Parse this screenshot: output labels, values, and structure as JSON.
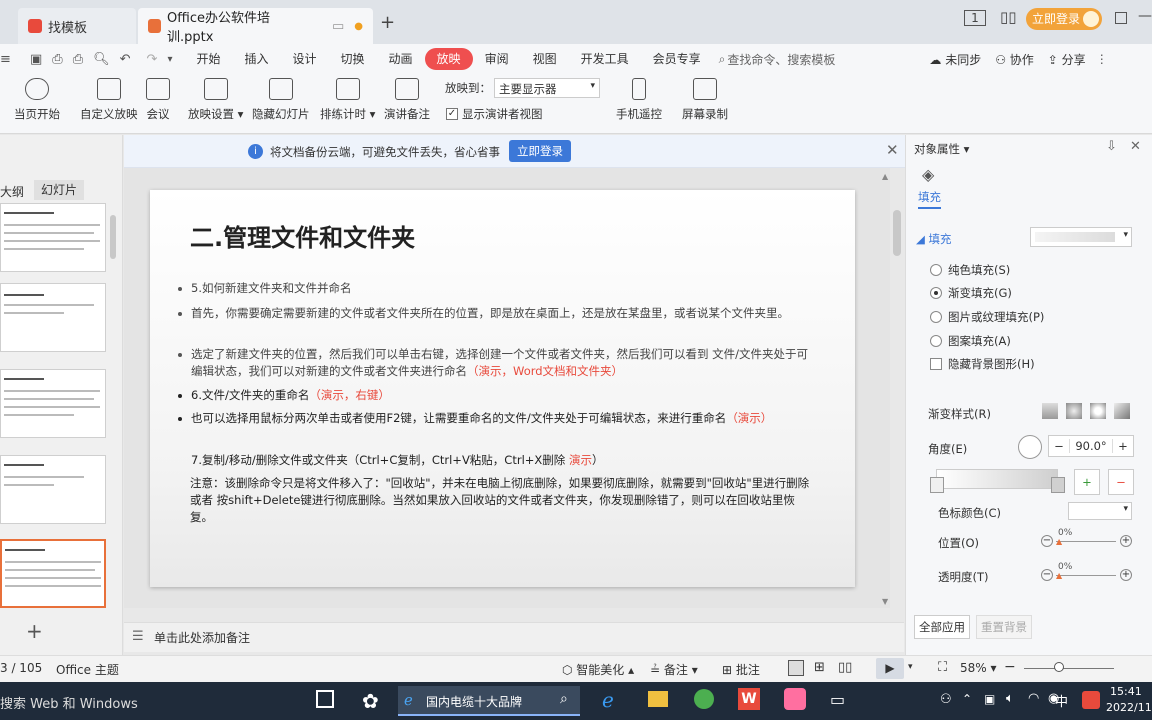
{
  "tabs": [
    {
      "label": "找模板",
      "color": "#e84a3c"
    },
    {
      "label": "Office办公软件培训.pptx",
      "color": "#e8703a"
    }
  ],
  "titlebar": {
    "login": "立即登录"
  },
  "menu": [
    "开始",
    "插入",
    "设计",
    "切换",
    "动画",
    "放映",
    "审阅",
    "视图",
    "开发工具",
    "会员专享"
  ],
  "menu_active": "放映",
  "search_placeholder": "查找命令、搜索模板",
  "menu_right": {
    "sync": "未同步",
    "collab": "协作",
    "share": "分享"
  },
  "ribbon": {
    "from_current": "当页开始",
    "custom": "自定义放映",
    "meeting": "会议",
    "settings": "放映设置",
    "hide": "隐藏幻灯片",
    "rehearse": "排练计时",
    "notes": "演讲备注",
    "play_to_label": "放映到：",
    "play_to_value": "主要显示器",
    "presenter_view": "显示演讲者视图",
    "remote": "手机遥控",
    "record": "屏幕录制"
  },
  "notification": {
    "text": "将文档备份云端，可避免文件丢失，省心省事",
    "button": "立即登录"
  },
  "left_tabs": {
    "outline": "大纲",
    "slides": "幻灯片"
  },
  "slide": {
    "title": "二.管理文件和文件夹",
    "b1": "5.如何新建文件夹和文件并命名",
    "b2": "首先，你需要确定需要新建的文件或者文件夹所在的位置，即是放在桌面上，还是放在某盘里，或者说某个文件夹里。",
    "b3": "选定了新建文件夹的位置，然后我们可以单击右键，选择创建一个文件或者文件夹，然后我们可以看到 文件/文件夹处于可编辑状态，我们可以对新建的文件或者文件夹进行命名",
    "b3_red": "（演示，Word文档和文件夹）",
    "b4": "6.文件/文件夹的重命名",
    "b4_red": "（演示，右键）",
    "b5": "也可以选择用鼠标分两次单击或者使用F2键，让需要重命名的文件/文件夹处于可编辑状态，来进行重命名",
    "b5_red": "（演示）",
    "b6": "7.复制/移动/删除文件或文件夹（Ctrl+C复制，Ctrl+V粘贴，Ctrl+X删除",
    "b6_red": "演示",
    "b6_end": "）",
    "note": "注意：该删除命令只是将文件移入了：\"回收站\"，并未在电脑上彻底删除，如果要彻底删除，就需要到\"回收站\"里进行删除或者 按shift+Delete键进行彻底删除。当然如果放入回收站的文件或者文件夹，你发现删除错了，则可以在回收站里恢复。"
  },
  "notes_placeholder": "单击此处添加备注",
  "right_panel": {
    "header": "对象属性",
    "tab": "填充",
    "section": "填充",
    "options": [
      "纯色填充(S)",
      "渐变填充(G)",
      "图片或纹理填充(P)",
      "图案填充(A)"
    ],
    "selected_option": "渐变填充(G)",
    "hide_bg": "隐藏背景图形(H)",
    "gradient_style": "渐变样式(R)",
    "angle_label": "角度(E)",
    "angle_value": "90.0°",
    "stop_color": "色标颜色(C)",
    "position": "位置(O)",
    "position_value": "0%",
    "transparency": "透明度(T)",
    "transparency_value": "0%",
    "apply_all": "全部应用",
    "reset_bg": "重置背景"
  },
  "status": {
    "page": "3 / 105",
    "theme": "Office 主题",
    "beautify": "智能美化",
    "notes": "备注",
    "comments": "批注",
    "zoom": "58%"
  },
  "taskbar": {
    "search": "搜索 Web 和 Windows",
    "browser_title": "国内电缆十大品牌",
    "ime": "中",
    "time": "15:41",
    "date": "2022/11"
  }
}
